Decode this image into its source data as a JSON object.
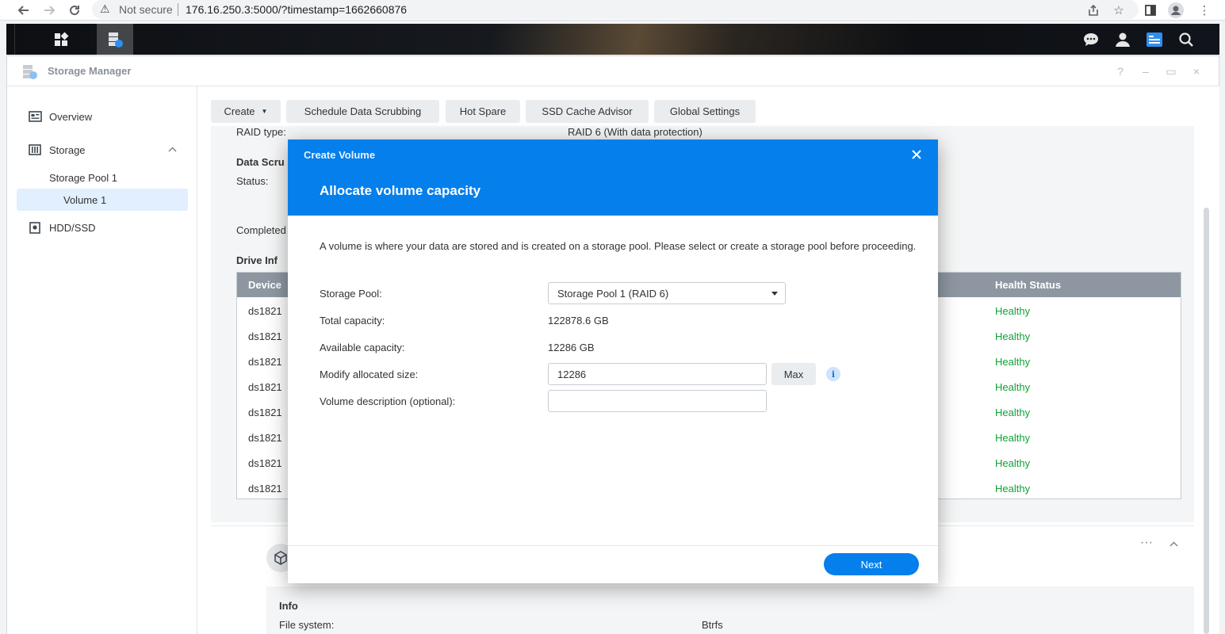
{
  "browser": {
    "not_secure": "Not secure",
    "url": "176.16.250.3:5000/?timestamp=1662660876"
  },
  "window": {
    "title": "Storage Manager",
    "controls": [
      "?",
      "–",
      "▭",
      "×"
    ]
  },
  "sidebar": {
    "items": [
      {
        "label": "Overview"
      },
      {
        "label": "Storage"
      },
      {
        "label": "Storage Pool 1"
      },
      {
        "label": "Volume 1"
      },
      {
        "label": "HDD/SSD"
      }
    ]
  },
  "toolbar": {
    "create": "Create",
    "scrub": "Schedule Data Scrubbing",
    "hot_spare": "Hot Spare",
    "ssd_cache": "SSD Cache Advisor",
    "global_settings": "Global Settings"
  },
  "background": {
    "raid_type_label": "RAID type:",
    "raid_type_value": "RAID 6 (With data protection)",
    "data_scrubbing": "Data Scru",
    "status_label": "Status:",
    "completed_label": "Completed",
    "drive_info": "Drive Inf",
    "table": {
      "headers": [
        "Device",
        "Health Status"
      ],
      "rows": [
        {
          "device": "ds1821",
          "health": "Healthy"
        },
        {
          "device": "ds1821",
          "health": "Healthy"
        },
        {
          "device": "ds1821",
          "health": "Healthy"
        },
        {
          "device": "ds1821",
          "health": "Healthy"
        },
        {
          "device": "ds1821",
          "health": "Healthy"
        },
        {
          "device": "ds1821",
          "health": "Healthy"
        },
        {
          "device": "ds1821",
          "health": "Healthy"
        },
        {
          "device": "ds1821",
          "health": "Healthy"
        }
      ]
    },
    "more": "···",
    "info_title": "Info",
    "file_system_label": "File system:",
    "file_system_value": "Btrfs"
  },
  "modal": {
    "app_title": "Create Volume",
    "title": "Allocate volume capacity",
    "description": "A volume is where your data are stored and is created on a storage pool. Please select or create a storage pool before proceeding.",
    "storage_pool_label": "Storage Pool:",
    "storage_pool_value": "Storage Pool 1 (RAID 6)",
    "total_capacity_label": "Total capacity:",
    "total_capacity_value": "122878.6 GB",
    "available_capacity_label": "Available capacity:",
    "available_capacity_value": "12286 GB",
    "modify_size_label": "Modify allocated size:",
    "modify_size_value": "12286",
    "max_label": "Max",
    "info_icon": "i",
    "description_label": "Volume description (optional):",
    "description_value": "",
    "next_label": "Next"
  },
  "colors": {
    "accent": "#057feb",
    "healthy": "#10a334",
    "table_header": "#8e97a1",
    "selected_nav": "#e1efff"
  }
}
